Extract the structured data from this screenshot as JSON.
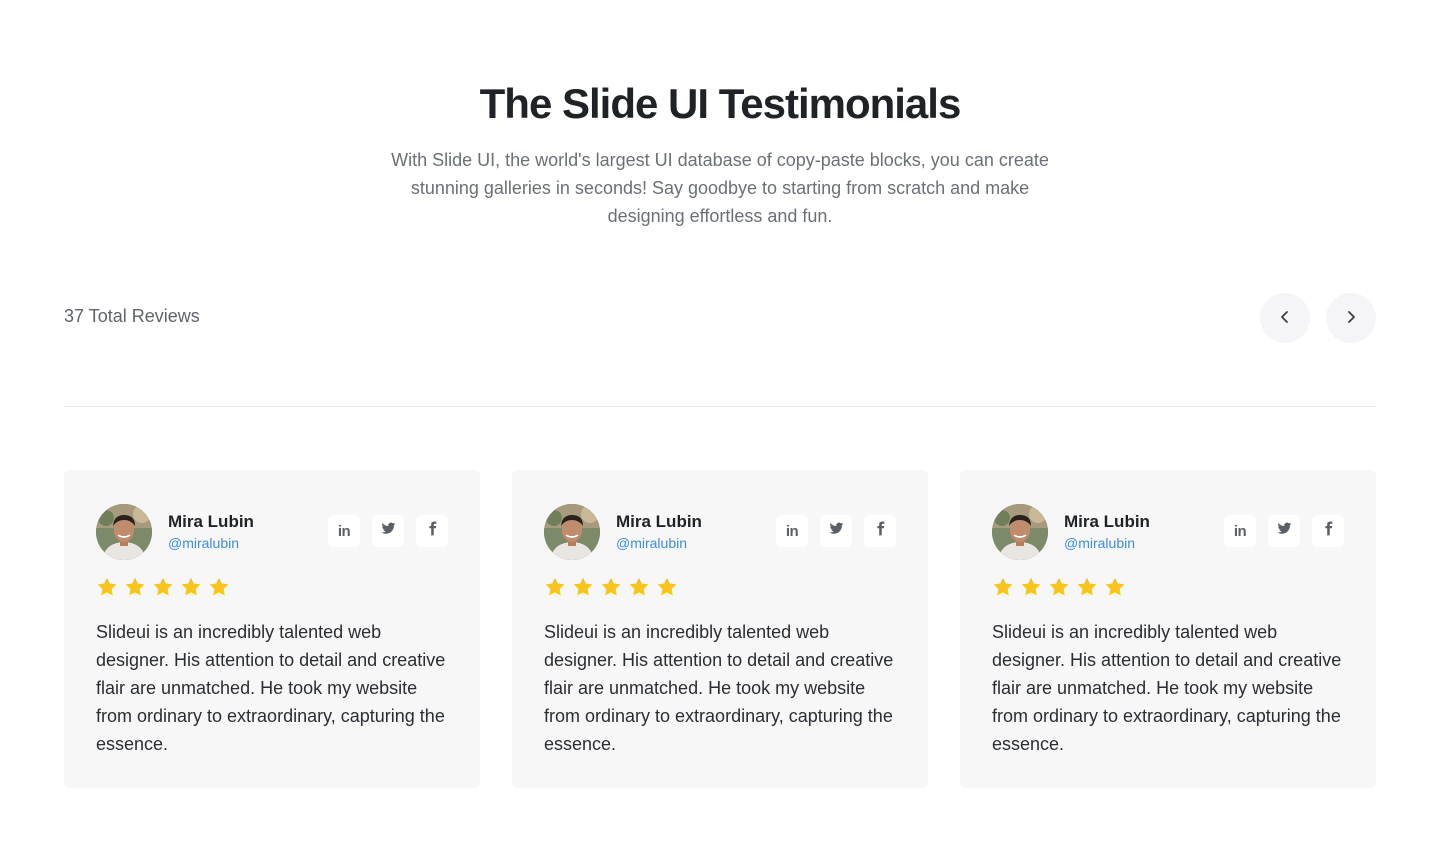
{
  "header": {
    "title": "The Slide UI Testimonials",
    "subtitle": "With Slide UI, the world's largest UI database of copy-paste blocks, you can create stunning galleries in seconds! Say goodbye to starting from scratch and make designing effortless and fun."
  },
  "reviews_bar": {
    "count_label": "37 Total Reviews",
    "prev_icon": "chevron-left-icon",
    "next_icon": "chevron-right-icon"
  },
  "colors": {
    "star": "#f7c31d",
    "handle": "#3b8ede",
    "card_bg": "#f7f7f8"
  },
  "cards": [
    {
      "name": "Mira Lubin",
      "handle": "@miralubin",
      "rating": 5,
      "rating_max": 5,
      "socials": [
        "linkedin-icon",
        "twitter-icon",
        "facebook-icon"
      ],
      "text": "Slideui is an incredibly talented web designer. His attention to detail and creative flair are unmatched. He took my website from ordinary to extraordinary, capturing the essence."
    },
    {
      "name": "Mira Lubin",
      "handle": "@miralubin",
      "rating": 5,
      "rating_max": 5,
      "socials": [
        "linkedin-icon",
        "twitter-icon",
        "facebook-icon"
      ],
      "text": "Slideui is an incredibly talented web designer. His attention to detail and creative flair are unmatched. He took my website from ordinary to extraordinary, capturing the essence."
    },
    {
      "name": "Mira Lubin",
      "handle": "@miralubin",
      "rating": 5,
      "rating_max": 5,
      "socials": [
        "linkedin-icon",
        "twitter-icon",
        "facebook-icon"
      ],
      "text": "Slideui is an incredibly talented web designer. His attention to detail and creative flair are unmatched. He took my website from ordinary to extraordinary, capturing the essence."
    }
  ]
}
